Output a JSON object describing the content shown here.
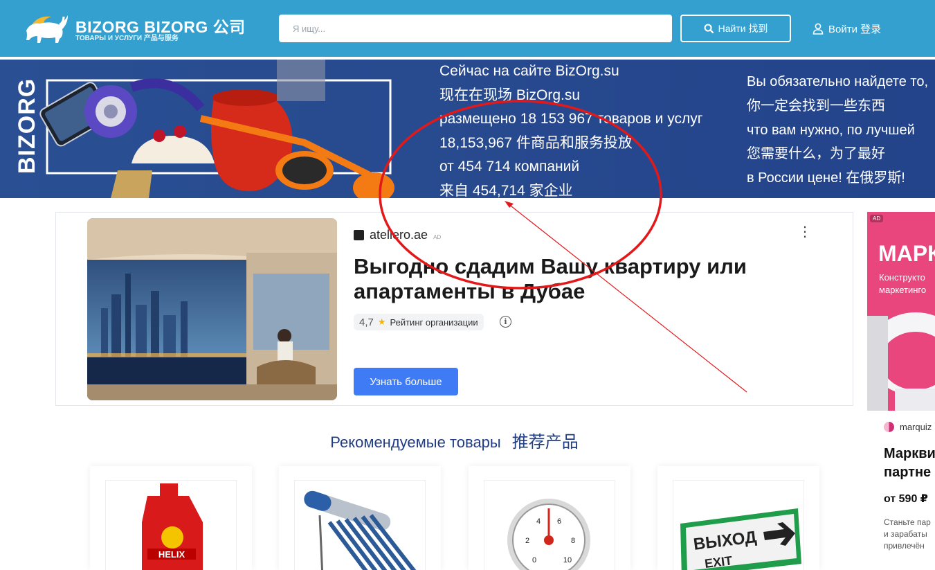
{
  "header": {
    "logo_title": "BIZORG  BIZORG 公司",
    "logo_subtitle": "ТОВАРЫ И УСЛУГИ  产品与服务",
    "search_placeholder": "Я ищу...",
    "find_button": "Найти  找到",
    "login": "Войти  登录",
    "colors": {
      "header_bg": "#33a0d0",
      "banner_bg": "#284a8f"
    }
  },
  "banner": {
    "vertical_brand": "BIZORG",
    "col1": [
      "Сейчас на сайте BizOrg.su",
      "现在在现场 BizOrg.su",
      "размещено 18 153 967 товаров и услуг",
      "18,153,967 件商品和服务投放",
      "от 454 714 компаний",
      "来自 454,714 家企业"
    ],
    "col2": [
      "Вы обязательно найдете то,",
      "你一定会找到一些东西",
      "что вам нужно, по лучшей",
      "您需要什么，为了最好",
      "в России цене!   在俄罗斯!"
    ]
  },
  "ad": {
    "source": "ateliero.ae",
    "ad_label": "AD",
    "headline": "Выгодно сдадим Вашу квартиру или апартаменты в Дубае",
    "rating_value": "4,7",
    "rating_label": "Рейтинг организации",
    "button": "Узнать больше",
    "kebab": "⋮"
  },
  "right_ad": {
    "badge": "AD",
    "title": "МАРК",
    "subtitle": [
      "Конструкто",
      "маркетинго"
    ],
    "source": "marquiz",
    "headline": [
      "Марквиз",
      "партне"
    ],
    "price": "от 590 ₽",
    "description": [
      "Станьте пар",
      "и зарабаты",
      "привлечён"
    ]
  },
  "recommended": {
    "title_ru": "Рекомендуемые товары",
    "title_zh": "推荐产品",
    "products": [
      {
        "name": "motor-oil",
        "label": "HELIX"
      },
      {
        "name": "solar-water-heater",
        "label": ""
      },
      {
        "name": "pressure-gauge",
        "label": ""
      },
      {
        "name": "exit-sign",
        "label_ru": "ВЫХОД",
        "label_en": "EXIT"
      }
    ]
  }
}
